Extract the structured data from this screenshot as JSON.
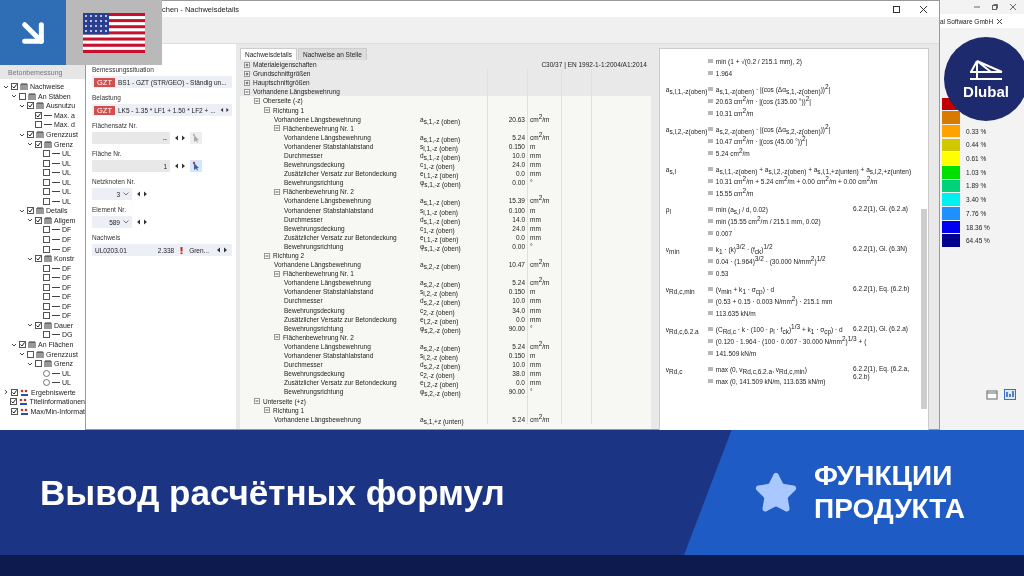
{
  "main_window": {
    "title": "al Software GmbH",
    "navigator": {
      "title": "Betonbemessung",
      "items": [
        {
          "label": "Nachweise",
          "kind": "group",
          "checked": true,
          "expanded": true,
          "children": [
            {
              "label": "An Stäben",
              "kind": "group",
              "checked": false,
              "expanded": true,
              "children": [
                {
                  "label": "Ausnutzu",
                  "kind": "group",
                  "checked": true,
                  "expanded": true,
                  "children": [
                    {
                      "label": "Max. a",
                      "kind": "leaf",
                      "checked": true
                    },
                    {
                      "label": "Max. d",
                      "kind": "leaf",
                      "checked": false
                    }
                  ]
                },
                {
                  "label": "Grenzzust",
                  "kind": "group",
                  "checked": true,
                  "expanded": true,
                  "children": [
                    {
                      "label": "Grenz",
                      "kind": "group",
                      "checked": true,
                      "expanded": true,
                      "children": [
                        {
                          "label": "UL",
                          "kind": "leaf",
                          "checked": false
                        },
                        {
                          "label": "UL",
                          "kind": "leaf",
                          "checked": false
                        },
                        {
                          "label": "UL",
                          "kind": "leaf",
                          "checked": false
                        },
                        {
                          "label": "UL",
                          "kind": "leaf",
                          "checked": false
                        },
                        {
                          "label": "UL",
                          "kind": "leaf",
                          "checked": false
                        },
                        {
                          "label": "UL",
                          "kind": "leaf",
                          "checked": false
                        }
                      ]
                    }
                  ]
                },
                {
                  "label": "Details",
                  "kind": "group",
                  "checked": true,
                  "expanded": true,
                  "children": [
                    {
                      "label": "Allgem",
                      "kind": "group",
                      "checked": true,
                      "expanded": true,
                      "children": [
                        {
                          "label": "DF",
                          "kind": "leaf",
                          "checked": false
                        },
                        {
                          "label": "DF",
                          "kind": "leaf",
                          "checked": false
                        },
                        {
                          "label": "DF",
                          "kind": "leaf",
                          "checked": false
                        }
                      ]
                    },
                    {
                      "label": "Konstr",
                      "kind": "group",
                      "checked": true,
                      "expanded": true,
                      "children": [
                        {
                          "label": "DF",
                          "kind": "leaf",
                          "checked": false
                        },
                        {
                          "label": "DF",
                          "kind": "leaf",
                          "checked": false
                        },
                        {
                          "label": "DF",
                          "kind": "leaf",
                          "checked": false
                        },
                        {
                          "label": "DF",
                          "kind": "leaf",
                          "checked": false
                        },
                        {
                          "label": "DF",
                          "kind": "leaf",
                          "checked": false
                        },
                        {
                          "label": "DF",
                          "kind": "leaf",
                          "checked": false
                        }
                      ]
                    },
                    {
                      "label": "Dauer",
                      "kind": "group",
                      "checked": true,
                      "expanded": true,
                      "children": [
                        {
                          "label": "DG",
                          "kind": "leaf",
                          "checked": false
                        }
                      ]
                    }
                  ]
                }
              ]
            },
            {
              "label": "An Flächen",
              "kind": "group",
              "checked": true,
              "expanded": true,
              "children": [
                {
                  "label": "Grenzzust",
                  "kind": "group",
                  "checked": false,
                  "expanded": true,
                  "children": [
                    {
                      "label": "Grenz",
                      "kind": "group",
                      "checked": false,
                      "expanded": true,
                      "children": [
                        {
                          "label": "UL",
                          "kind": "radio",
                          "checked": false
                        },
                        {
                          "label": "UL",
                          "kind": "radio",
                          "checked": false
                        }
                      ]
                    }
                  ]
                }
              ]
            }
          ]
        },
        {
          "label": "Ergebniswerte",
          "kind": "result",
          "checked": true,
          "expanded": false
        },
        {
          "label": "Titelinformationen",
          "kind": "result",
          "checked": true
        },
        {
          "label": "Max/Min-Informat",
          "kind": "result",
          "checked": true
        }
      ]
    },
    "legend": [
      {
        "color": "#c00000"
      },
      {
        "color": "#d87a00"
      },
      {
        "color": "#ffa200",
        "label": "0.33 %"
      },
      {
        "color": "#d2c800",
        "label": "0.44 %"
      },
      {
        "color": "#ffff00",
        "label": "0.61 %"
      },
      {
        "color": "#00e000",
        "label": "1.03 %"
      },
      {
        "color": "#00d27a",
        "label": "1.89 %"
      },
      {
        "color": "#00f0f0",
        "label": "3.40 %"
      },
      {
        "color": "#1e90ff",
        "label": "7.76 %"
      },
      {
        "color": "#0000f0",
        "label": "18.36 %"
      },
      {
        "color": "#00008f",
        "label": "64.45 %"
      }
    ]
  },
  "dialog": {
    "title": "chen - Nachweisdetails",
    "fields": [
      {
        "label": "Bemessungssituation",
        "kind": "combo",
        "tag": "GZT",
        "value": "BS1 - GZT (STR/GEO) - Ständig un..."
      },
      {
        "label": "Belastung",
        "kind": "combo",
        "tag": "GZT",
        "value": "LK5 - 1.35 * LF1 + 1.50 * LF2 + ..."
      },
      {
        "label": "Flächensatz Nr.",
        "kind": "spinner",
        "value": "--",
        "disabled": true
      },
      {
        "label": "Fläche Nr.",
        "kind": "spinner",
        "value": "1",
        "disabled": false
      },
      {
        "label": "Netzknoten Nr.",
        "kind": "select",
        "value": "3"
      },
      {
        "label": "Element Nr.",
        "kind": "select",
        "value": "589"
      },
      {
        "label": "Nachweis",
        "kind": "result",
        "value": "UL0203.01",
        "ratio": "2.338",
        "type": "Gren..."
      }
    ],
    "tabs": [
      {
        "label": "Nachweisdetails",
        "selected": true
      },
      {
        "label": "Nachweise an Stelle",
        "selected": false
      }
    ],
    "table": {
      "rows": [
        {
          "label": "Materialeigenschaften",
          "expanded": false,
          "note": "C30/37 | EN 1992-1-1:2004/A1:2014"
        },
        {
          "label": "Grundschnittgrößen",
          "expanded": false
        },
        {
          "label": "Hauptschnittgrößen",
          "expanded": false
        },
        {
          "label": "Vorhandene Längsbewehrung",
          "expanded": true,
          "children": [
            {
              "label": "Oberseite (-z)",
              "expanded": true,
              "children": [
                {
                  "label": "Richtung 1",
                  "expanded": true,
                  "children": [
                    {
                      "label": "Vorhandene Längsbewehrung",
                      "symbol": "a$_{s,1,-z (oben)}$",
                      "value": "20.63",
                      "unit": "cm$^{2}$/m"
                    },
                    {
                      "label": "Flächenbewehrung Nr. 1",
                      "expanded": true,
                      "children": [
                        {
                          "label": "Vorhandene Längsbewehrung",
                          "symbol": "a$_{s,1,-z (oben)}$",
                          "value": "5.24",
                          "unit": "cm$^{2}$/m"
                        },
                        {
                          "label": "Vorhandener Stabstahlabstand",
                          "symbol": "s$_{l,1,-z (oben)}$",
                          "value": "0.150",
                          "unit": "m"
                        },
                        {
                          "label": "Durchmesser",
                          "symbol": "d$_{s,1,-z (oben)}$",
                          "value": "10.0",
                          "unit": "mm"
                        },
                        {
                          "label": "Bewehrungsdeckung",
                          "symbol": "c$_{1,-z (oben)}$",
                          "value": "24.0",
                          "unit": "mm"
                        },
                        {
                          "label": "Zusätzlicher Versatz zur Betondeckung",
                          "symbol": "e$_{l,1,-z (oben)}$",
                          "value": "0.0",
                          "unit": "mm"
                        },
                        {
                          "label": "Bewehrungsrichtung",
                          "symbol": "φ$_{s,1,-z (oben)}$",
                          "value": "0.00",
                          "unit": "°"
                        }
                      ]
                    },
                    {
                      "label": "Flächenbewehrung Nr. 2",
                      "expanded": true,
                      "children": [
                        {
                          "label": "Vorhandene Längsbewehrung",
                          "symbol": "a$_{s,1,-z (oben)}$",
                          "value": "15.39",
                          "unit": "cm$^{2}$/m"
                        },
                        {
                          "label": "Vorhandener Stabstahlabstand",
                          "symbol": "s$_{l,1,-z (oben)}$",
                          "value": "0.100",
                          "unit": "m"
                        },
                        {
                          "label": "Durchmesser",
                          "symbol": "d$_{s,1,-z (oben)}$",
                          "value": "14.0",
                          "unit": "mm"
                        },
                        {
                          "label": "Bewehrungsdeckung",
                          "symbol": "c$_{1,-z (oben)}$",
                          "value": "24.0",
                          "unit": "mm"
                        },
                        {
                          "label": "Zusätzlicher Versatz zur Betondeckung",
                          "symbol": "e$_{l,1,-z (oben)}$",
                          "value": "0.0",
                          "unit": "mm"
                        },
                        {
                          "label": "Bewehrungsrichtung",
                          "symbol": "φ$_{s,1,-z (oben)}$",
                          "value": "0.00",
                          "unit": "°"
                        }
                      ]
                    }
                  ]
                },
                {
                  "label": "Richtung 2",
                  "expanded": true,
                  "children": [
                    {
                      "label": "Vorhandene Längsbewehrung",
                      "symbol": "a$_{s,2,-z (oben)}$",
                      "value": "10.47",
                      "unit": "cm$^{2}$/m"
                    },
                    {
                      "label": "Flächenbewehrung Nr. 1",
                      "expanded": true,
                      "children": [
                        {
                          "label": "Vorhandene Längsbewehrung",
                          "symbol": "a$_{s,2,-z (oben)}$",
                          "value": "5.24",
                          "unit": "cm$^{2}$/m"
                        },
                        {
                          "label": "Vorhandener Stabstahlabstand",
                          "symbol": "s$_{l,2,-z (oben)}$",
                          "value": "0.150",
                          "unit": "m"
                        },
                        {
                          "label": "Durchmesser",
                          "symbol": "d$_{s,2,-z (oben)}$",
                          "value": "10.0",
                          "unit": "mm"
                        },
                        {
                          "label": "Bewehrungsdeckung",
                          "symbol": "c$_{2,-z (oben)}$",
                          "value": "34.0",
                          "unit": "mm"
                        },
                        {
                          "label": "Zusätzlicher Versatz zur Betondeckung",
                          "symbol": "e$_{l,2,-z (oben)}$",
                          "value": "0.0",
                          "unit": "mm"
                        },
                        {
                          "label": "Bewehrungsrichtung",
                          "symbol": "φ$_{s,2,-z (oben)}$",
                          "value": "90.00",
                          "unit": "°"
                        }
                      ]
                    },
                    {
                      "label": "Flächenbewehrung Nr. 2",
                      "expanded": true,
                      "children": [
                        {
                          "label": "Vorhandene Längsbewehrung",
                          "symbol": "a$_{s,2,-z (oben)}$",
                          "value": "5.24",
                          "unit": "cm$^{2}$/m"
                        },
                        {
                          "label": "Vorhandener Stabstahlabstand",
                          "symbol": "s$_{l,2,-z (oben)}$",
                          "value": "0.150",
                          "unit": "m"
                        },
                        {
                          "label": "Durchmesser",
                          "symbol": "d$_{s,2,-z (oben)}$",
                          "value": "10.0",
                          "unit": "mm"
                        },
                        {
                          "label": "Bewehrungsdeckung",
                          "symbol": "c$_{2,-z (oben)}$",
                          "value": "38.0",
                          "unit": "mm"
                        },
                        {
                          "label": "Zusätzlicher Versatz zur Betondeckung",
                          "symbol": "e$_{l,2,-z (oben)}$",
                          "value": "0.0",
                          "unit": "mm"
                        },
                        {
                          "label": "Bewehrungsrichtung",
                          "symbol": "φ$_{s,2,-z (oben)}$",
                          "value": "90.00",
                          "unit": "°"
                        }
                      ]
                    }
                  ]
                }
              ]
            },
            {
              "label": "Unterseite (+z)",
              "expanded": true,
              "children": [
                {
                  "label": "Richtung 1",
                  "expanded": true,
                  "children": [
                    {
                      "label": "Vorhandene Längsbewehrung",
                      "symbol": "a$_{s,1,+z (unten)}$",
                      "value": "5.24",
                      "unit": "cm$^{2}$/m"
                    }
                  ]
                }
              ]
            }
          ]
        }
      ]
    },
    "formulas": [
      {
        "lines": [
          "min (1 + √(0.2 / 215.1 mm), 2)",
          "1.964"
        ]
      },
      {
        "lhs": "a$_{s,l,1,-z(oben)}$",
        "lines": [
          "a$_{s,1,-z(oben)}$ · |(cos (Δα$_{s,1,-z(oben)}$))$^{2}$|",
          "20.63 cm$^{2}$/m · |(cos (135.00 °))$^{2}$|",
          "10.31 cm$^{2}$/m"
        ]
      },
      {
        "lhs": "a$_{s,l,2,-z(oben)}$",
        "lines": [
          "a$_{s,2,-z(oben)}$ · |(cos (Δα$_{s,2,-z(oben)}$))$^{2}$|",
          "10.47 cm$^{2}$/m · |(cos (45.00 °))$^{2}$|",
          "5.24 cm$^{2}$/m"
        ]
      },
      {
        "lhs": "a$_{s,l}$",
        "lines": [
          "a$_{s,l,1,-z(oben)}$ + a$_{s,l,2,-z(oben)}$ + a$_{s,l,1,+z(unten)}$ + a$_{s,l,2,+z(unten)}$",
          "10.31 cm$^{2}$/m + 5.24 cm$^{2}$/m + 0.00 cm$^{2}$/m + 0.00 cm$^{2}$/m",
          "15.55 cm$^{2}$/m"
        ]
      },
      {
        "lhs": "ρ$_{l}$",
        "ref": "6.2.2(1), Gl. (6.2.a)",
        "lines": [
          "min (a$_{s,l}$ / d, 0.02)",
          "min (15.55 cm$^{2}$/m / 215.1 mm, 0.02)",
          "0.007"
        ]
      },
      {
        "lhs": "v$_{min}$",
        "ref": "6.2.2(1), Gl. (6.3N)",
        "lines": [
          "k$_{1}$ · (k)$^{3/2}$ · (f$_{ck}$)$^{1/2}$",
          "0.04 · (1.964)$^{3/2}$ · (30.000 N/mm$^{2}$)$^{1/2}$",
          "0.53"
        ]
      },
      {
        "lhs": "v$_{Rd,c,min}$",
        "ref": "6.2.2(1), Eq. (6.2.b)",
        "lines": [
          "(v$_{min}$ + k$_{1}$ · σ$_{cp}$) · d",
          "(0.53 + 0.15 · 0.003 N/mm$^{2}$) · 215.1 mm",
          "113.635 kN/m"
        ]
      },
      {
        "lhs": "v$_{Rd,c,6.2.a}$",
        "ref": "6.2.2(1), Gl. (6.2.a)",
        "lines": [
          "(C$_{Rd,c}$ · k · (100 · ρ$_{l}$ · f$_{ck}$)$^{1/3}$ + k$_{1}$ · σ$_{cp}$) · d",
          "(0.120 · 1.964 · (100 · 0.007 · 30.000 N/mm$^{2}$)$^{1/3}$ + (",
          "141.509 kN/m"
        ]
      },
      {
        "lhs": "v$_{Rd,c}$",
        "ref": "6.2.2(1), Eq. (6.2.a, 6.2.b)",
        "lines": [
          "max (0, v$_{Rd,c,6.2.a}$, v$_{Rd,c,min}$)",
          "max (0, 141.509 kN/m, 113.635 kN/m)"
        ]
      }
    ]
  },
  "logo": {
    "text": "Dlubal"
  },
  "banner": {
    "title": "Вывод расчётных формул",
    "tag_lines": [
      "ФУНКЦИИ",
      "ПРОДУКТА"
    ]
  }
}
